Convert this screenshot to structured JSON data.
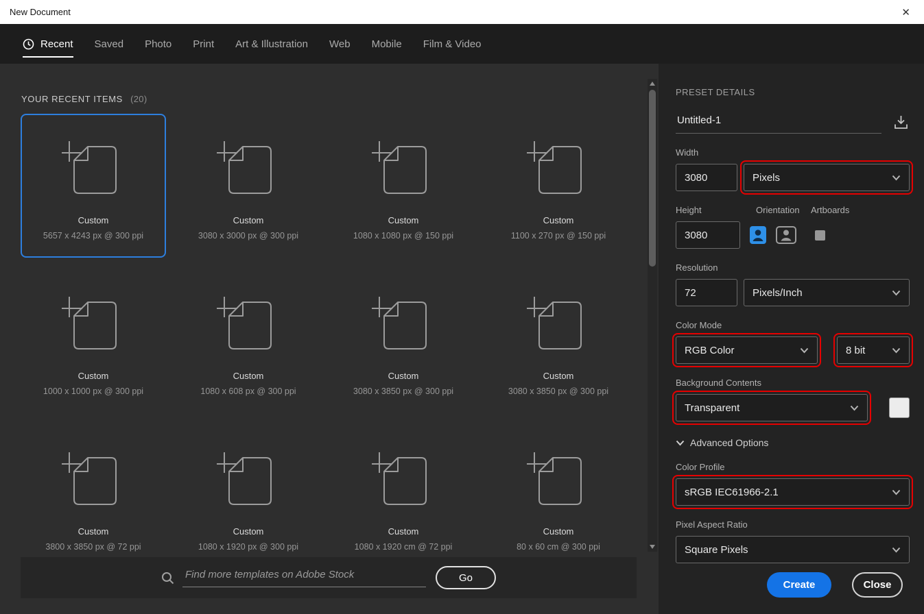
{
  "window": {
    "title": "New Document",
    "close_glyph": "✕"
  },
  "tabs": [
    {
      "label": "Recent",
      "active": true
    },
    {
      "label": "Saved"
    },
    {
      "label": "Photo"
    },
    {
      "label": "Print"
    },
    {
      "label": "Art & Illustration"
    },
    {
      "label": "Web"
    },
    {
      "label": "Mobile"
    },
    {
      "label": "Film & Video"
    }
  ],
  "recent": {
    "heading": "YOUR RECENT ITEMS",
    "count": "(20)",
    "cards": [
      {
        "title": "Custom",
        "dims": "5657 x 4243 px @ 300 ppi",
        "selected": true
      },
      {
        "title": "Custom",
        "dims": "3080 x 3000 px @ 300 ppi"
      },
      {
        "title": "Custom",
        "dims": "1080 x 1080 px @ 150 ppi"
      },
      {
        "title": "Custom",
        "dims": "1100 x 270 px @ 150 ppi"
      },
      {
        "title": "Custom",
        "dims": "1000 x 1000 px @ 300 ppi"
      },
      {
        "title": "Custom",
        "dims": "1080 x 608 px @ 300 ppi"
      },
      {
        "title": "Custom",
        "dims": "3080 x 3850 px @ 300 ppi"
      },
      {
        "title": "Custom",
        "dims": "3080 x 3850 px @ 300 ppi"
      },
      {
        "title": "Custom",
        "dims": "3800 x 3850 px @ 72 ppi"
      },
      {
        "title": "Custom",
        "dims": "1080 x 1920 px @ 300 ppi"
      },
      {
        "title": "Custom",
        "dims": "1080 x 1920 cm @ 72 ppi"
      },
      {
        "title": "Custom",
        "dims": "80 x 60 cm @ 300 ppi"
      }
    ],
    "stock_search": {
      "placeholder": "Find more templates on Adobe Stock",
      "go": "Go"
    }
  },
  "preset": {
    "heading": "PRESET DETAILS",
    "doc_name": "Untitled-1",
    "width_label": "Width",
    "width_value": "3080",
    "width_unit": "Pixels",
    "height_label": "Height",
    "height_value": "3080",
    "orientation_label": "Orientation",
    "artboards_label": "Artboards",
    "resolution_label": "Resolution",
    "resolution_value": "72",
    "resolution_unit": "Pixels/Inch",
    "color_mode_label": "Color Mode",
    "color_mode_value": "RGB Color",
    "bit_depth_value": "8 bit",
    "background_label": "Background Contents",
    "background_value": "Transparent",
    "advanced_label": "Advanced Options",
    "profile_label": "Color Profile",
    "profile_value": "sRGB IEC61966-2.1",
    "aspect_label": "Pixel Aspect Ratio",
    "aspect_value": "Square Pixels",
    "create": "Create",
    "close": "Close"
  },
  "colors": {
    "accent_blue": "#1473e6",
    "selection_blue": "#2d7fdf",
    "annotation_red": "#e60000",
    "panel_dark": "#232323",
    "main_dark": "#2e2e2e"
  }
}
